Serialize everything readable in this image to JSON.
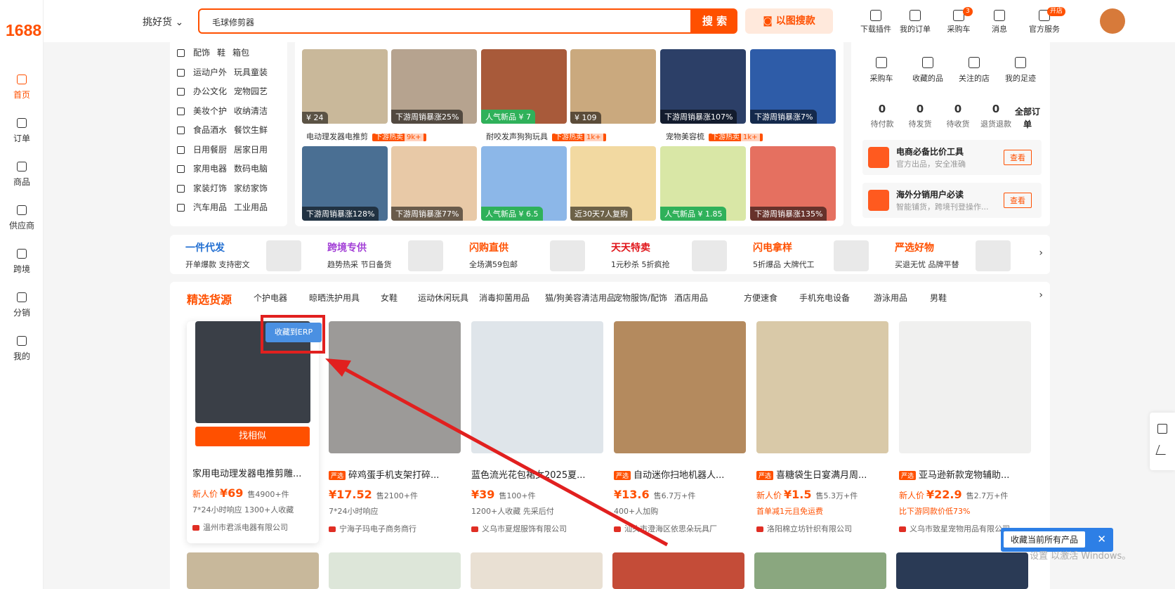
{
  "brand": {
    "logo": "1688"
  },
  "leftnav": [
    {
      "label": "首页",
      "icon": "home-icon",
      "active": true
    },
    {
      "label": "订单",
      "icon": "order-icon"
    },
    {
      "label": "商品",
      "icon": "grid-icon"
    },
    {
      "label": "供应商",
      "icon": "supplier-icon"
    },
    {
      "label": "跨境",
      "icon": "globe-icon"
    },
    {
      "label": "分销",
      "icon": "distribute-icon"
    },
    {
      "label": "我的",
      "icon": "profile-icon"
    }
  ],
  "search": {
    "picker": "挑好货",
    "query": "毛球修剪器",
    "button": "搜 索",
    "image_search": "以图搜款"
  },
  "topnav": [
    {
      "label": "下载插件",
      "icon": "plugin-icon"
    },
    {
      "label": "我的订单",
      "icon": "order-icon"
    },
    {
      "label": "采购车",
      "icon": "cart-icon",
      "badge": "3"
    },
    {
      "label": "消息",
      "icon": "message-icon"
    },
    {
      "label": "官方服务",
      "icon": "service-icon",
      "badge": "开店"
    }
  ],
  "categories": [
    [
      "配饰",
      "鞋",
      "箱包"
    ],
    [
      "运动户外",
      "玩具童装"
    ],
    [
      "办公文化",
      "宠物园艺"
    ],
    [
      "美妆个护",
      "收纳清洁"
    ],
    [
      "食品酒水",
      "餐饮生鲜"
    ],
    [
      "日用餐厨",
      "居家日用"
    ],
    [
      "家用电器",
      "数码电脑"
    ],
    [
      "家装灯饰",
      "家纺家饰"
    ],
    [
      "汽车用品",
      "工业用品"
    ]
  ],
  "hot_groups": [
    {
      "name": "电动理发器电推剪",
      "hot": "下游热卖",
      "count": "9k+"
    },
    {
      "name": "耐咬发声狗狗玩具",
      "hot": "下游热卖",
      "count": "1k+"
    },
    {
      "name": "宠物美容梳",
      "hot": "下游热卖",
      "count": "1k+"
    }
  ],
  "grid_row1": [
    {
      "tag": "¥ 24",
      "color": "#c9b89a"
    },
    {
      "tag": "下游周销暴涨25%",
      "color": "#b6a38f"
    },
    {
      "tag": "人气新品 ¥ 7",
      "color": "#a85a3a",
      "green": true
    },
    {
      "tag": "¥ 109",
      "color": "#caa97e"
    },
    {
      "tag": "下游周销暴涨107%",
      "color": "#2c3f67"
    },
    {
      "tag": "下游周销暴涨7%",
      "color": "#2e5ca8"
    }
  ],
  "grid_row2": [
    {
      "tag": "下游周销暴涨128%",
      "color": "#4a6f93"
    },
    {
      "tag": "下游周销暴涨77%",
      "color": "#e8c9a7"
    },
    {
      "tag": "人气新品 ¥ 6.5",
      "color": "#8cb7e8",
      "green": true
    },
    {
      "tag": "近30天7人复购",
      "color": "#f2d9a1"
    },
    {
      "tag": "人气新品 ¥ 1.85",
      "color": "#d9e7a6",
      "green": true
    },
    {
      "tag": "下游周销暴涨135%",
      "color": "#e57060"
    }
  ],
  "quick": [
    {
      "label": "采购车",
      "icon": "cart-icon"
    },
    {
      "label": "收藏的品",
      "icon": "star-icon"
    },
    {
      "label": "关注的店",
      "icon": "shop-icon"
    },
    {
      "label": "我的足迹",
      "icon": "footprint-icon"
    }
  ],
  "orders": [
    {
      "count": "0",
      "label": "待付款"
    },
    {
      "count": "0",
      "label": "待发货"
    },
    {
      "count": "0",
      "label": "待收货"
    },
    {
      "count": "0",
      "label": "退货退款"
    }
  ],
  "orders_all": "全部订单",
  "promos": [
    {
      "title": "电商必备比价工具",
      "sub": "官方出品，安全准确",
      "btn": "查看"
    },
    {
      "title": "海外分销用户必读",
      "sub": "智能铺货，跨境刊登操作...",
      "btn": "查看"
    }
  ],
  "strip": [
    {
      "title": "一件代发",
      "sub": "开单爆款 支持密文",
      "color": "#1f6dd1"
    },
    {
      "title": "跨境专供",
      "sub": "趋势热采 节日备货",
      "color": "#a23fd6"
    },
    {
      "title": "闪购直供",
      "sub": "全场满59包邮",
      "color": "#ff5000"
    },
    {
      "title": "天天特卖",
      "sub": "1元秒杀 5折疯抢",
      "color": "#e0161b"
    },
    {
      "title": "闪电拿样",
      "sub": "5折爆品 大牌代工",
      "color": "#ff5000"
    },
    {
      "title": "严选好物",
      "sub": "买退无忧 品牌平替",
      "color": "#ff5000"
    }
  ],
  "selection": {
    "title": "精选货源",
    "tabs": [
      "个护电器",
      "晾晒洗护用具",
      "女鞋",
      "运动休闲玩具",
      "消毒抑菌用品",
      "猫/狗美容清洁用品",
      "宠物服饰/配饰",
      "酒店用品",
      "方便速食",
      "手机充电设备",
      "游泳用品",
      "男鞋"
    ]
  },
  "products": [
    {
      "title": "家用电动理发器电推剪雕...",
      "tag": "",
      "prefix": "新人价",
      "price": "¥69",
      "sold": "售4900+件",
      "info": "7*24小时响应 1300+人收藏",
      "shop": "温州市君派电器有限公司",
      "img": "#3a3f47"
    },
    {
      "title": "碎鸡蛋手机支架打碎...",
      "tag": "严选",
      "prefix": "",
      "price": "¥17.52",
      "sold": "售2100+件",
      "info": "7*24小时响应",
      "shop": "宁海子玛电子商务商行",
      "img": "#9c9a98"
    },
    {
      "title": "蓝色流光花包裙女2025夏...",
      "tag": "",
      "prefix": "",
      "price": "¥39",
      "sold": "售100+件",
      "info": "1200+人收藏 先采后付",
      "shop": "义乌市夏煜服饰有限公司",
      "img": "#dfe5ea"
    },
    {
      "title": "自动迷你扫地机器人...",
      "tag": "严选",
      "prefix": "",
      "price": "¥13.6",
      "sold": "售6.7万+件",
      "info": "400+人加购",
      "shop": "汕头市澄海区依思朵玩具厂",
      "img": "#b48a5e"
    },
    {
      "title": "喜糖袋生日宴满月周...",
      "tag": "严选",
      "prefix": "新人价",
      "price": "¥1.5",
      "sold": "售5.3万+件",
      "info": "首单减1元且免运费",
      "infoRed": true,
      "shop": "洛阳棉立坊针织有限公司",
      "img": "#d9c9a8"
    },
    {
      "title": "亚马逊新款宠物辅助...",
      "tag": "严选",
      "prefix": "新人价",
      "price": "¥22.9",
      "sold": "售2.7万+件",
      "info": "比下游同款价低73%",
      "infoRed": true,
      "shop": "义乌市致星宠物用品有限公司",
      "img": "#f0f0ef"
    }
  ],
  "card_actions": {
    "find_similar": "找相似",
    "erp": "收藏到ERP"
  },
  "toast": {
    "text": "收藏当前所有产品"
  },
  "watermark": "设置 以激活 Windows。"
}
